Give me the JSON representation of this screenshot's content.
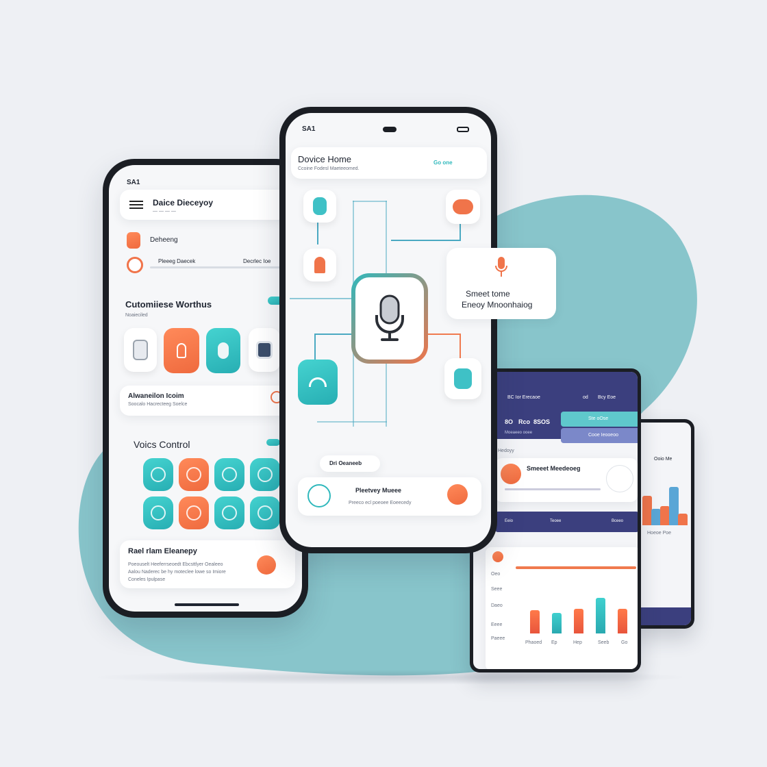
{
  "colors": {
    "teal": "#2fb8bc",
    "orange": "#f0744a",
    "navy": "#3b3f7e",
    "background": "#eef0f4"
  },
  "left_phone": {
    "status_time": "SA1",
    "header_title": "Daice Dieceyoy",
    "row1_label": "Deheeng",
    "row2_left": "Pleeeg Daecek",
    "row2_right": "Decrlec Ioe",
    "section1_title": "Cutomiiese Worthus",
    "section1_sub": "Noaieciled",
    "automation_title": "Alwaneilon Icoim",
    "automation_sub": "Soocalo Hacrecteeg Soelce",
    "voice_title": "Voics Control",
    "bottom_title": "Rael rlam Eleanepy",
    "bottom_line1": "Poeouselt Heeferrseoedt Ebcsttlyer Oealeeo",
    "bottom_line2": "Aalou Naderec be hy moteclee lowe so Imiore",
    "bottom_line3": "Coneles Ipulpase"
  },
  "center_phone": {
    "status_time": "SA1",
    "header_title": "Dovice Home",
    "header_sub": "Ccoine Fodesl Maeteeomed.",
    "header_badge": "Go one",
    "center_icon": "microphone-icon",
    "chip_label": "Dri Oeaneeb",
    "footer_title": "Pleetvey Mueee",
    "footer_sub": "Preeco ecl poeoee Eoeecedy"
  },
  "floating_card": {
    "line1": "Smeet tome",
    "line2": "Eneoy Mnoonhaiog"
  },
  "tablet": {
    "header_items": [
      "BC Ior Erecaoe",
      "od",
      "Bcy Eoe"
    ],
    "row_values": [
      "8O",
      "Rco",
      "8SOS"
    ],
    "row_label": "Moeaeeo ooee",
    "teal_labels": [
      "Ste oOse",
      "Cooe Ieooeoo"
    ],
    "section_label": "Hedoyy",
    "monitor_title": "Smeeet Meedeoeg",
    "navy_labels": [
      "Eeio",
      "Teoee",
      "Bceeo"
    ],
    "chart_labels": [
      "Oeo",
      "Seee",
      "Daeo",
      "Eeee",
      "Paeee"
    ],
    "chart_xlabels": [
      "Phaoed",
      "Ep",
      "Hep",
      "Seeb",
      "Go"
    ]
  },
  "tablet_chart": {
    "type": "bar",
    "values": [
      0.45,
      0.4,
      0.48,
      0.68,
      0.48
    ]
  },
  "small_phone": {
    "label": "Ooio Me",
    "sub": "Hoeoe Poe"
  },
  "small_chart": {
    "type": "bar",
    "values": [
      0.62,
      0.35,
      0.4,
      0.8,
      0.25
    ]
  }
}
